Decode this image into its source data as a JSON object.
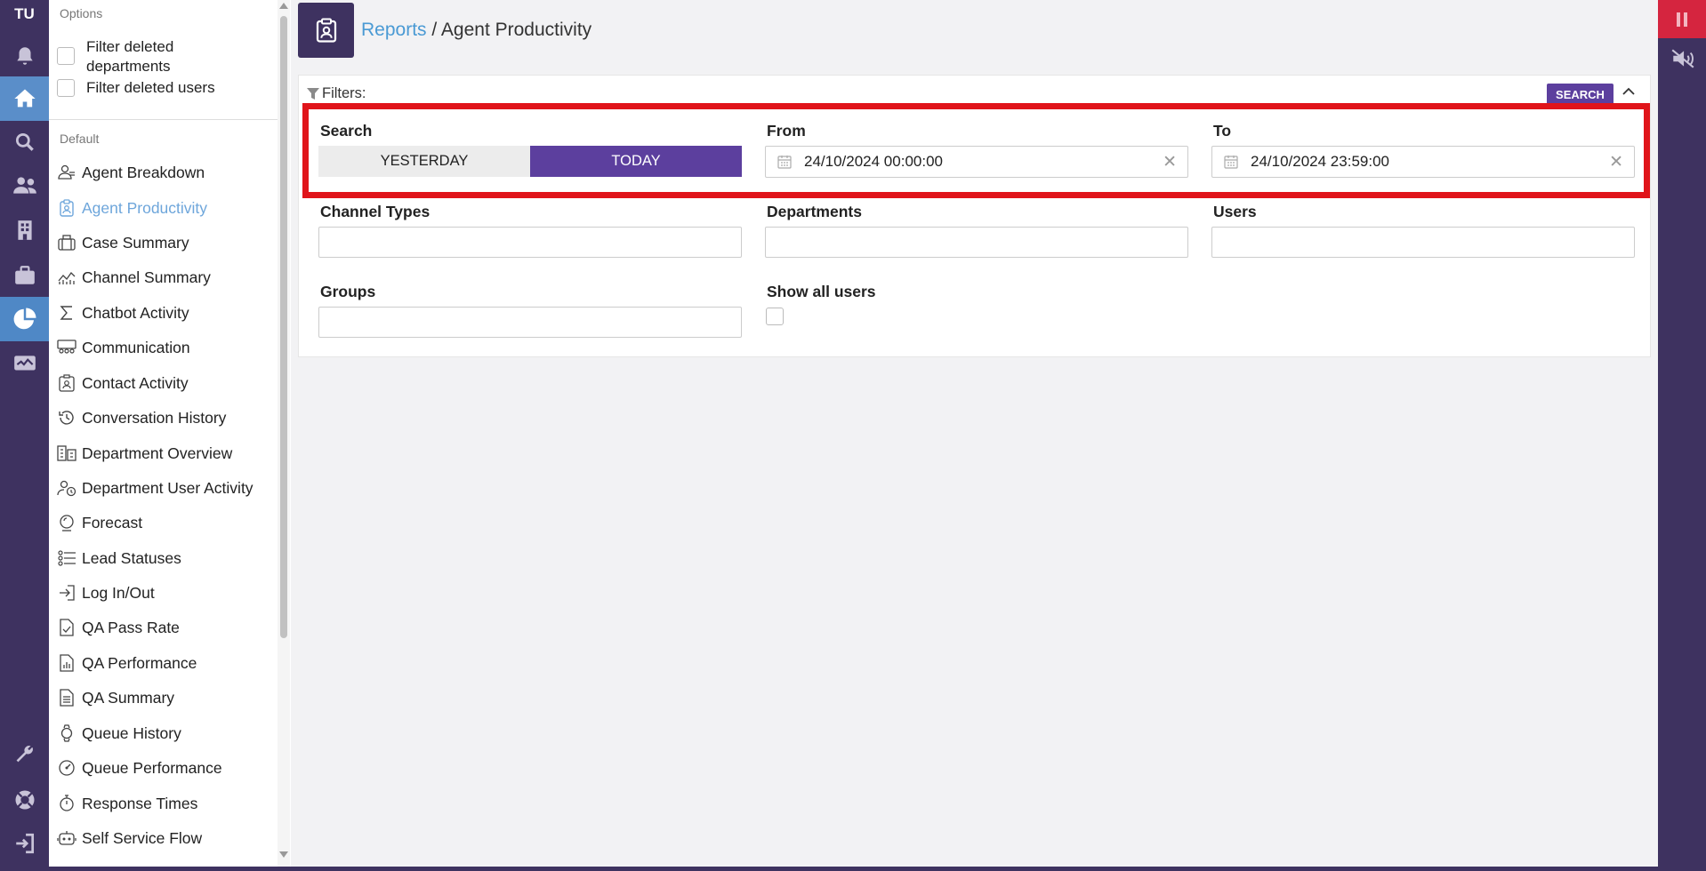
{
  "rail": {
    "brand": "TU",
    "icons": [
      "bell-icon",
      "home-icon",
      "search-icon",
      "users-icon",
      "building-icon",
      "briefcase-icon",
      "pie-chart-icon",
      "monitor-chart-icon",
      "wrench-icon",
      "lifebuoy-icon",
      "logout-icon"
    ]
  },
  "sidebar": {
    "options_title": "Options",
    "options": [
      {
        "label": "Filter deleted departments",
        "checked": false
      },
      {
        "label": "Filter deleted users",
        "checked": false
      }
    ],
    "default_title": "Default",
    "items": [
      {
        "label": "Agent Breakdown",
        "icon": "user-breakdown-icon"
      },
      {
        "label": "Agent Productivity",
        "icon": "clipboard-user-icon",
        "active": true
      },
      {
        "label": "Case Summary",
        "icon": "briefcase-icon"
      },
      {
        "label": "Channel Summary",
        "icon": "line-chart-icon"
      },
      {
        "label": "Chatbot Activity",
        "icon": "sigma-icon"
      },
      {
        "label": "Communication",
        "icon": "people-board-icon"
      },
      {
        "label": "Contact Activity",
        "icon": "contact-card-icon"
      },
      {
        "label": "Conversation History",
        "icon": "history-icon"
      },
      {
        "label": "Department Overview",
        "icon": "department-icon"
      },
      {
        "label": "Department User Activity",
        "icon": "user-clock-icon"
      },
      {
        "label": "Forecast",
        "icon": "forecast-icon"
      },
      {
        "label": "Lead Statuses",
        "icon": "lead-list-icon"
      },
      {
        "label": "Log In/Out",
        "icon": "login-icon"
      },
      {
        "label": "QA Pass Rate",
        "icon": "doc-check-icon"
      },
      {
        "label": "QA Performance",
        "icon": "doc-chart-icon"
      },
      {
        "label": "QA Summary",
        "icon": "doc-list-icon"
      },
      {
        "label": "Queue History",
        "icon": "watch-icon"
      },
      {
        "label": "Queue Performance",
        "icon": "gauge-icon"
      },
      {
        "label": "Response Times",
        "icon": "stopwatch-icon"
      },
      {
        "label": "Self Service Flow",
        "icon": "robot-icon"
      }
    ]
  },
  "header": {
    "breadcrumb_link": "Reports",
    "breadcrumb_sep": "/",
    "title": "Agent Productivity"
  },
  "filters": {
    "title": "Filters:",
    "search_button": "SEARCH",
    "search_label": "Search",
    "yesterday": "YESTERDAY",
    "today": "TODAY",
    "from_label": "From",
    "from_value": "24/10/2024 00:00:00",
    "to_label": "To",
    "to_value": "24/10/2024 23:59:00",
    "channel_types_label": "Channel Types",
    "departments_label": "Departments",
    "users_label": "Users",
    "groups_label": "Groups",
    "show_all_users_label": "Show all users",
    "show_all_users_checked": false
  },
  "colors": {
    "rail": "#3e3260",
    "accent": "#5c3f9e",
    "link": "#4a9ad4",
    "highlight": "#e0141a",
    "pause": "#d5253f"
  }
}
